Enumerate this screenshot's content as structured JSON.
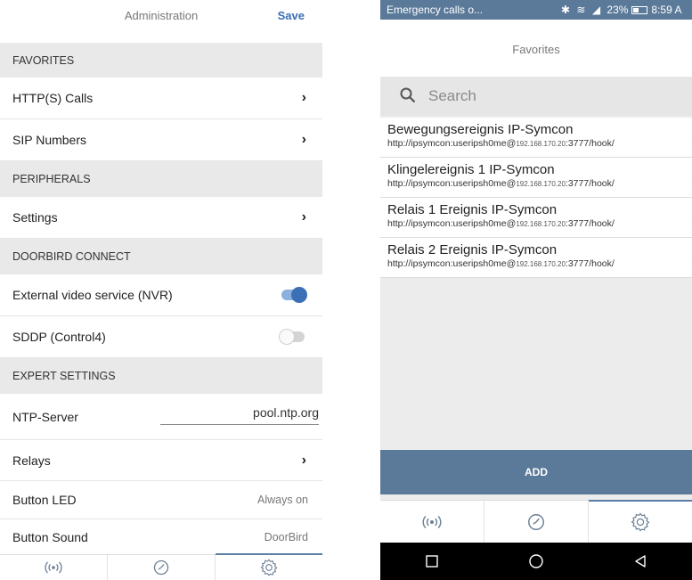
{
  "left": {
    "header": {
      "title": "Administration",
      "save_label": "Save"
    },
    "sections": {
      "favorites": "FAVORITES",
      "peripherals": "PERIPHERALS",
      "doorbird_connect": "DOORBIRD CONNECT",
      "expert_settings": "EXPERT SETTINGS"
    },
    "items": {
      "http_calls": "HTTP(S) Calls",
      "sip_numbers": "SIP Numbers",
      "settings": "Settings",
      "external_video": "External video service (NVR)",
      "sddp": "SDDP (Control4)",
      "ntp_server": "NTP-Server",
      "ntp_value": "pool.ntp.org",
      "relays": "Relays",
      "button_led": "Button LED",
      "button_led_value": "Always on",
      "button_sound": "Button Sound",
      "button_sound_value": "DoorBird"
    },
    "toggles": {
      "external_video": true,
      "sddp": false
    },
    "icons": {
      "chevron": "›"
    },
    "tabs": [
      "broadcast-icon",
      "history-icon",
      "settings-icon"
    ],
    "active_tab": 2
  },
  "right": {
    "status_bar": {
      "carrier": "Emergency calls o...",
      "battery": "23%",
      "time": "8:59 A"
    },
    "title": "Favorites",
    "search": {
      "placeholder": "Search"
    },
    "favorites": [
      {
        "name": "Bewegungsereignis IP-Symcon",
        "url_prefix": "http://ipsymcon:useripsh0me@",
        "ip": "192.168.170.20",
        "url_suffix": ":3777/hook/"
      },
      {
        "name": "Klingelereignis 1 IP-Symcon",
        "url_prefix": "http://ipsymcon:useripsh0me@",
        "ip": "192.168.170.20",
        "url_suffix": ":3777/hook/"
      },
      {
        "name": "Relais 1 Ereignis IP-Symcon",
        "url_prefix": "http://ipsymcon:useripsh0me@",
        "ip": "192.168.170.20",
        "url_suffix": ":3777/hook/"
      },
      {
        "name": "Relais 2 Ereignis IP-Symcon",
        "url_prefix": "http://ipsymcon:useripsh0me@",
        "ip": "192.168.170.20",
        "url_suffix": ":3777/hook/"
      }
    ],
    "add_label": "ADD",
    "tabs": [
      "broadcast-icon",
      "history-icon",
      "settings-icon"
    ],
    "active_tab": 2,
    "nav": [
      "square-nav-icon",
      "circle-home-icon",
      "triangle-back-icon"
    ]
  },
  "colors": {
    "accent": "#3b6fb6",
    "bar": "#5b7a99",
    "section_bg": "#e9e9e9"
  }
}
